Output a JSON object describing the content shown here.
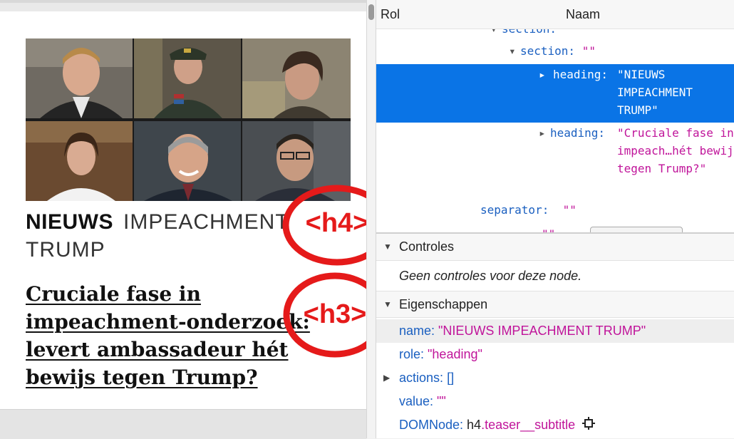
{
  "webpage": {
    "subtitle": {
      "kicker": "NIEUWS",
      "topic": "IMPEACHMENT TRUMP"
    },
    "headline": "Cruciale fase in impeachment-onderzoek: levert ambassadeur hét bewijs tegen Trump?",
    "annotations": {
      "h4": "<h4>",
      "h3": "<h3>"
    },
    "annotation_color": "#e51a1a",
    "photos": [
      "portrait-1",
      "portrait-2",
      "portrait-3",
      "portrait-4",
      "portrait-5",
      "portrait-6"
    ]
  },
  "inspector": {
    "columns": {
      "role": "Rol",
      "name": "Naam"
    },
    "tree": {
      "section_partial": "section:",
      "section": {
        "key": "section:",
        "value": "\"\""
      },
      "selected_heading": {
        "key": "heading:",
        "value": "\"NIEUWS IMPEACHMENT TRUMP\""
      },
      "heading2": {
        "key": "heading:",
        "value": "\"Cruciale fase in impeach…hét bewijs tegen Trump?\""
      },
      "separator": {
        "key": "separator:",
        "value": "\"\""
      },
      "partial_row": "\"\""
    },
    "selection_color": "#0a74e6",
    "controls": {
      "title": "Controles",
      "empty": "Geen controles voor deze node."
    },
    "properties": {
      "title": "Eigenschappen",
      "name": {
        "key": "name",
        "value": "\"NIEUWS IMPEACHMENT TRUMP\""
      },
      "role": {
        "key": "role",
        "value": "\"heading\""
      },
      "actions": {
        "key": "actions",
        "value": "[]"
      },
      "value": {
        "key": "value",
        "value": "\"\""
      },
      "dom_node": {
        "key": "DOMNode",
        "element": "h4",
        "class": ".teaser__subtitle"
      }
    }
  }
}
